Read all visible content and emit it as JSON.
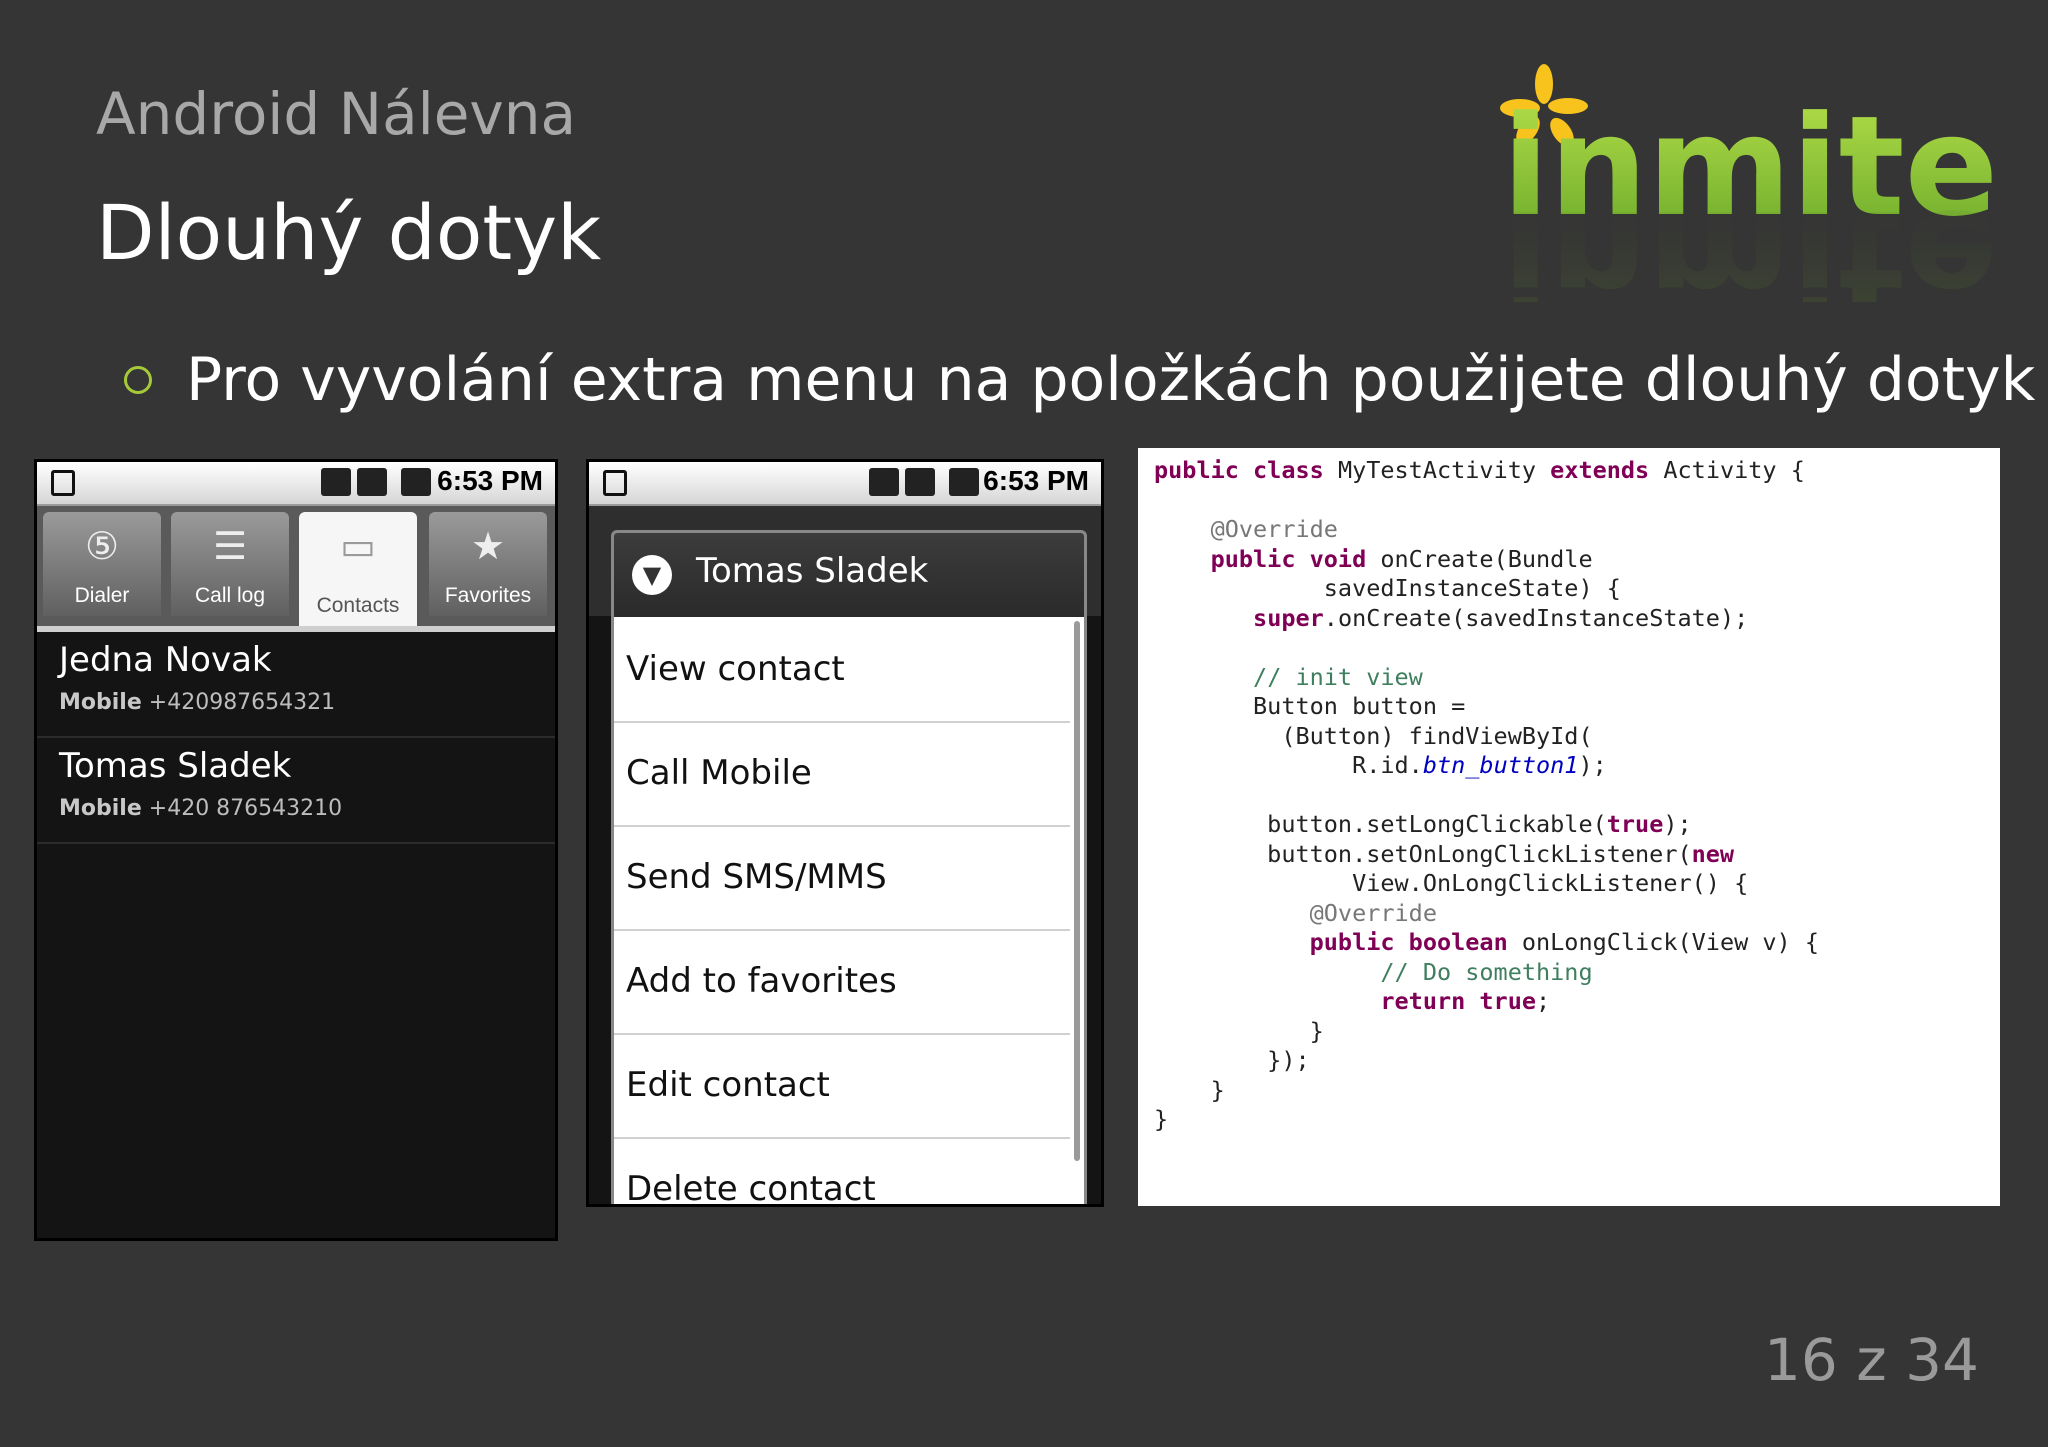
{
  "slide": {
    "subtitle": "Android Nálevna",
    "title": "Dlouhý dotyk",
    "bullet": "Pro vyvolání extra menu na položkách použijete dlouhý dotyk",
    "page": "16 z 34",
    "logo_text": "inmite",
    "colors": {
      "background": "#353535",
      "logo_green": "#8cc63f",
      "bullet": "#a6c93a"
    }
  },
  "phone1": {
    "time": "6:53 PM",
    "tabs": [
      {
        "label": "Dialer",
        "icon": "dialer-icon"
      },
      {
        "label": "Call log",
        "icon": "call-log-icon"
      },
      {
        "label": "Contacts",
        "icon": "contacts-icon"
      },
      {
        "label": "Favorites",
        "icon": "star-icon"
      }
    ],
    "contacts": [
      {
        "name": "Jedna Novak",
        "type": "Mobile",
        "number": "+420987654321"
      },
      {
        "name": "Tomas Sladek",
        "type": "Mobile",
        "number": "+420 876543210"
      }
    ]
  },
  "phone2": {
    "time": "6:53 PM",
    "dialog_title": "Tomas Sladek",
    "menu": [
      "View contact",
      "Call Mobile",
      "Send SMS/MMS",
      "Add to favorites",
      "Edit contact",
      "Delete contact"
    ]
  },
  "code": {
    "class_decl": "MyTestActivity",
    "parent": "Activity",
    "comment1": "// init view",
    "comment2": "// Do something",
    "field": "btn_button1"
  }
}
